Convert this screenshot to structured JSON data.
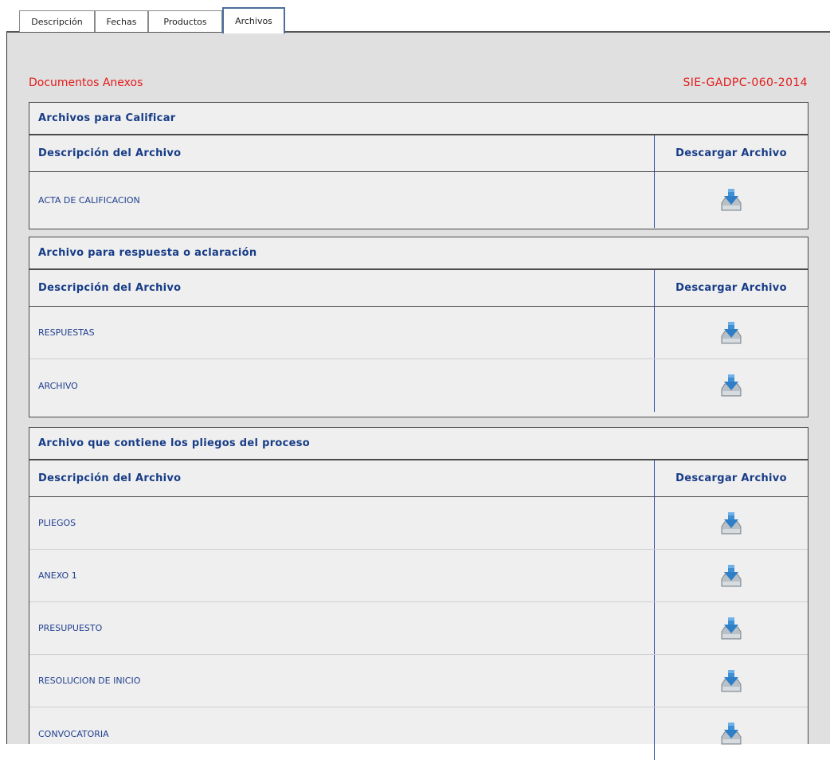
{
  "tabs": [
    {
      "label": "Descripción"
    },
    {
      "label": "Fechas"
    },
    {
      "label": "Productos"
    },
    {
      "label": "Archivos"
    }
  ],
  "header": {
    "left": "Documentos Anexos",
    "right": "SIE-GADPC-060-2014"
  },
  "columns": {
    "description": "Descripción del Archivo",
    "download": "Descargar Archivo"
  },
  "sections": [
    {
      "title": "Archivos para Calificar",
      "rows": [
        "ACTA DE CALIFICACION"
      ]
    },
    {
      "title": "Archivo para respuesta o aclaración",
      "rows": [
        "RESPUESTAS",
        "ARCHIVO"
      ]
    },
    {
      "title": "Archivo que contiene los pliegos del proceso",
      "rows": [
        "PLIEGOS",
        "ANEXO 1",
        "PRESUPUESTO",
        "RESOLUCION DE INICIO",
        "CONVOCATORIA"
      ]
    }
  ],
  "icons": {
    "download": "download-icon"
  },
  "colors": {
    "accent_red": "#e31b1b",
    "title_blue": "#173c87",
    "panel_bg": "#e0e0e0"
  }
}
